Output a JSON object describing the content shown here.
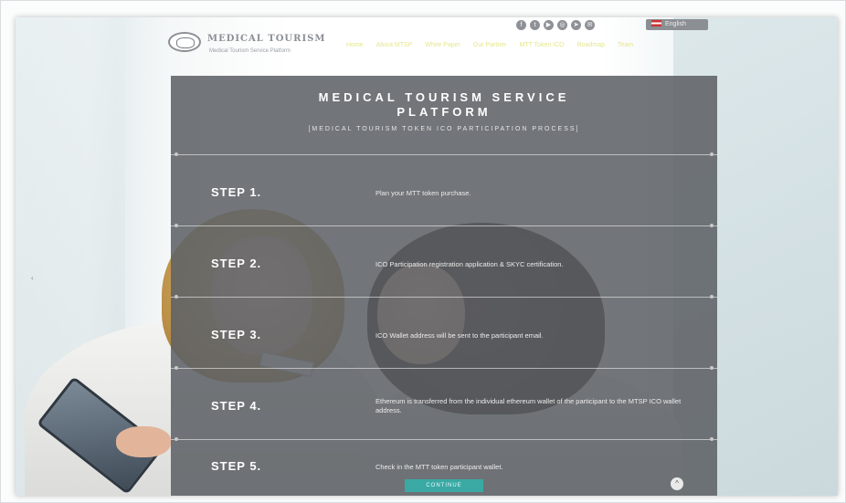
{
  "header": {
    "brand_title": "MEDICAL TOURISM",
    "brand_subtitle": "Medical Tourism Service Platform",
    "language": "English",
    "social_icons": [
      "facebook-icon",
      "twitter-icon",
      "youtube-icon",
      "instagram-icon",
      "telegram-icon",
      "mail-icon"
    ],
    "nav": [
      "Home",
      "About MTSP",
      "White Paper",
      "Our Partner",
      "MTT Token ICO",
      "Roadmap",
      "Team"
    ]
  },
  "panel": {
    "title_line1": "MEDICAL TOURISM SERVICE",
    "title_line2": "PLATFORM",
    "subtitle": "[MEDICAL TOURISM TOKEN ICO PARTICIPATION PROCESS]",
    "steps": [
      {
        "label": "STEP 1.",
        "text": "Plan your MTT token purchase."
      },
      {
        "label": "STEP 2.",
        "text": "ICO Participation registration application & SKYC certification."
      },
      {
        "label": "STEP 3.",
        "text": "ICO Wallet address will be sent to the participant email."
      },
      {
        "label": "STEP 4.",
        "text": "Ethereum is transferred from the individual ethereum wallet of the participant to the MTSP ICO wallet address."
      },
      {
        "label": "STEP 5.",
        "text": "Check in the MTT token participant wallet."
      }
    ],
    "continue_label": "CONTINUE",
    "scroll_top_glyph": "^"
  },
  "colors": {
    "overlay": "#5f6266",
    "accent_button": "#3aa9a4",
    "nav_text": "#e6e88a",
    "title_text": "#ffffff"
  }
}
